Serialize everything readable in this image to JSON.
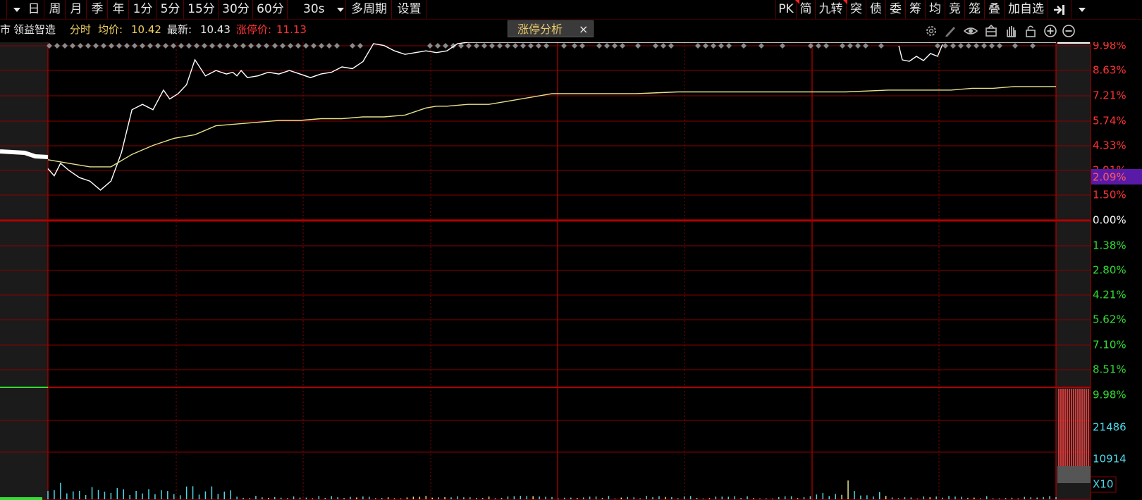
{
  "toolbar": {
    "left": [
      {
        "label": "日"
      },
      {
        "label": "周"
      },
      {
        "label": "月"
      },
      {
        "label": "季"
      },
      {
        "label": "年"
      },
      {
        "label": "1分"
      },
      {
        "label": "5分"
      },
      {
        "label": "15分"
      },
      {
        "label": "30分"
      },
      {
        "label": "60分"
      },
      {
        "label": "30s"
      },
      {
        "label": "多周期"
      },
      {
        "label": "设置"
      }
    ],
    "right": [
      {
        "label": "PK"
      },
      {
        "label": "简"
      },
      {
        "label": "九转"
      },
      {
        "label": "突"
      },
      {
        "label": "债"
      },
      {
        "label": "委"
      },
      {
        "label": "筹"
      },
      {
        "label": "均"
      },
      {
        "label": "竞"
      },
      {
        "label": "笼"
      },
      {
        "label": "叠"
      },
      {
        "label": "加自选"
      }
    ]
  },
  "info": {
    "left_cut": "市",
    "stock_name": "领益智造",
    "mode": "分时",
    "avg_label": "均价:",
    "avg_value": "10.42",
    "last_label": "最新:",
    "last_value": "10.43",
    "limit_label": "涨停价:",
    "limit_value": "11.13",
    "tag_label": "涨停分析",
    "tag_close": "×"
  },
  "colors": {
    "grid": "#8b0000",
    "up": "#ff3333",
    "down": "#33dd33",
    "price_line": "#ffffff",
    "avg_line": "#e6e08a",
    "vol_cyan": "#4dd8e8",
    "vol_yellow": "#e6e08a",
    "badge_bg": "#5a1aa8"
  },
  "chart_data": {
    "type": "line",
    "ylim": [
      -9.98,
      9.98
    ],
    "y_ticks_up": [
      "9.98%",
      "8.63%",
      "7.21%",
      "5.74%",
      "4.33%",
      "2.91%",
      "1.50%"
    ],
    "y_tick_zero": "0.00%",
    "y_ticks_down": [
      "1.38%",
      "2.80%",
      "4.21%",
      "5.62%",
      "7.10%",
      "8.51%",
      "9.98%"
    ],
    "current_badge": "2.09%",
    "series": [
      {
        "x": [
          0,
          3,
          6,
          10,
          15,
          20,
          25,
          30,
          35,
          40,
          45,
          50,
          55,
          58,
          62,
          66,
          70,
          75,
          80,
          85,
          88,
          90,
          92,
          95,
          100,
          105,
          110,
          115,
          120,
          125,
          130,
          135,
          140,
          145,
          150,
          155,
          160,
          165,
          170,
          175,
          180,
          185,
          190,
          195,
          200,
          205,
          210,
          215,
          218,
          220,
          225,
          230,
          235,
          240,
          245,
          250,
          255,
          258,
          260,
          270,
          280,
          290,
          300,
          310,
          320,
          330,
          340,
          345,
          350,
          355,
          360,
          370,
          380,
          390,
          400,
          410,
          420,
          430,
          440,
          450,
          460,
          470,
          480
        ],
        "values": [
          2.9,
          2.5,
          3.2,
          2.8,
          2.4,
          2.2,
          1.7,
          2.2,
          3.8,
          6.2,
          6.5,
          6.2,
          7.3,
          6.8,
          7.1,
          7.6,
          9.0,
          8.1,
          8.4,
          8.2,
          8.3,
          8.1,
          8.4,
          8.0,
          8.1,
          8.3,
          8.2,
          8.4,
          8.2,
          8.0,
          8.2,
          8.3,
          8.6,
          8.5,
          8.9,
          9.9,
          9.8,
          9.5,
          9.3,
          9.4,
          9.5,
          9.4,
          9.5,
          9.9,
          9.98,
          9.98,
          9.98,
          9.98,
          9.98,
          9.98,
          9.98,
          9.98,
          9.98,
          9.98,
          9.98,
          9.98,
          9.98,
          9.98,
          9.98,
          9.98,
          9.98,
          9.98,
          9.98,
          9.98,
          9.98,
          9.98,
          9.98,
          9.98,
          9.98,
          9.98,
          9.98,
          9.98,
          9.98,
          9.98,
          9.98,
          9.98,
          9.98,
          9.98,
          9.98,
          9.98,
          9.98,
          9.98,
          9.98
        ]
      },
      {
        "x": [
          0,
          10,
          20,
          30,
          40,
          50,
          60,
          70,
          80,
          90,
          100,
          110,
          120,
          130,
          140,
          150,
          160,
          170,
          180,
          185,
          190,
          200,
          210,
          220,
          240,
          260,
          280,
          300,
          320,
          340,
          360,
          380,
          400,
          410,
          420,
          430,
          440,
          450,
          460,
          470,
          480
        ],
        "values": [
          3.4,
          3.2,
          3.0,
          3.0,
          3.7,
          4.2,
          4.6,
          4.8,
          5.3,
          5.4,
          5.5,
          5.6,
          5.6,
          5.7,
          5.7,
          5.8,
          5.8,
          5.9,
          6.3,
          6.4,
          6.4,
          6.5,
          6.5,
          6.7,
          7.1,
          7.1,
          7.1,
          7.2,
          7.2,
          7.2,
          7.2,
          7.2,
          7.3,
          7.3,
          7.3,
          7.3,
          7.4,
          7.4,
          7.5,
          7.5,
          7.5
        ]
      }
    ]
  },
  "volume": {
    "label_top": "9.98%",
    "tick_mid": "21486",
    "tick_low": "10914",
    "unit": "X10",
    "max": 32000
  }
}
